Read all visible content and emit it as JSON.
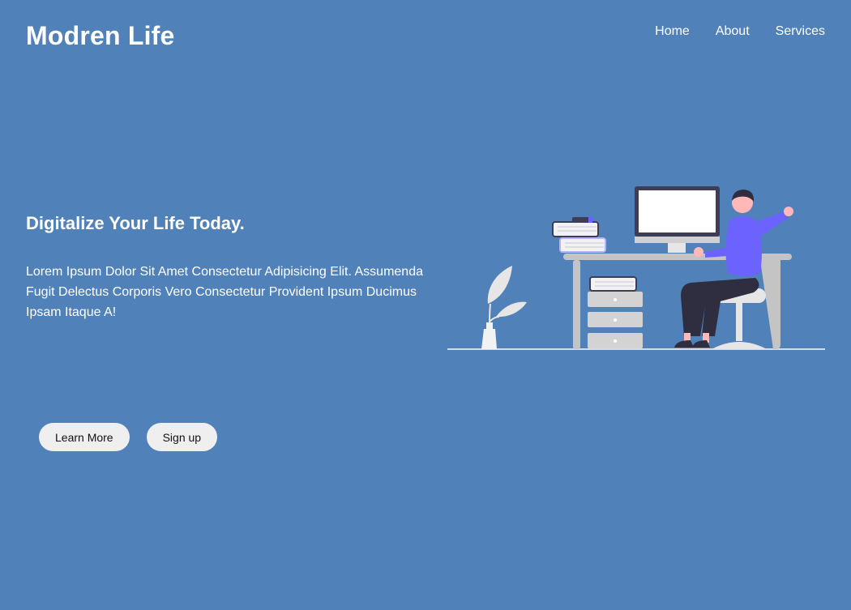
{
  "header": {
    "logo": "Modren Life",
    "nav": [
      "Home",
      "About",
      "Services"
    ]
  },
  "hero": {
    "headline": "Digitalize Your Life Today.",
    "body": "Lorem Ipsum Dolor Sit Amet Consectetur Adipisicing Elit. Assumenda Fugit Delectus Corporis Vero Consectetur Provident Ipsum Ducimus Ipsam Itaque A!",
    "buttons": {
      "learn_more": "Learn More",
      "sign_up": "Sign up"
    },
    "illustration_icon": "person-working-at-desk-illustration"
  },
  "colors": {
    "background": "#5082b9",
    "accent": "#6c63ff",
    "button_bg": "#efefef"
  }
}
